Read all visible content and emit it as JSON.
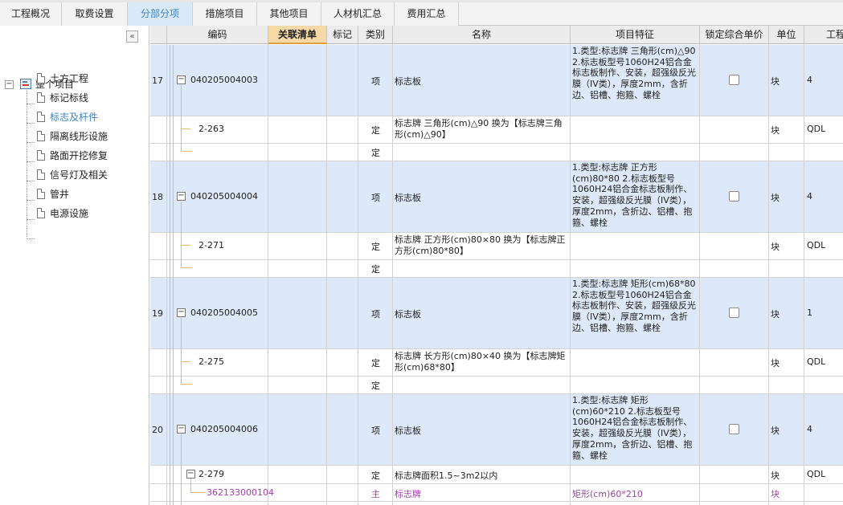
{
  "tabs": [
    {
      "label": "工程概况"
    },
    {
      "label": "取费设置"
    },
    {
      "label": "分部分项"
    },
    {
      "label": "措施项目"
    },
    {
      "label": "其他项目"
    },
    {
      "label": "人材机汇总"
    },
    {
      "label": "费用汇总"
    }
  ],
  "active_tab": "分部分项",
  "tree": {
    "collapse_glyph": "«",
    "root_label": "整个项目",
    "items": [
      {
        "label": "土方工程"
      },
      {
        "label": "标记标线"
      },
      {
        "label": "标志及杆件"
      },
      {
        "label": "隔离线形设施"
      },
      {
        "label": "路面开挖修复"
      },
      {
        "label": "信号灯及相关"
      },
      {
        "label": "管井"
      },
      {
        "label": "电源设施"
      }
    ],
    "selected_index": 2
  },
  "grid": {
    "headers": [
      "编码",
      "关联清单",
      "标记",
      "类别",
      "名称",
      "项目特征",
      "锁定综合单价",
      "单位",
      "工程"
    ],
    "highlight_header": "关联清单",
    "groups": [
      {
        "no": "17",
        "code": "040205004003",
        "category": "项",
        "name": "标志板",
        "features": "1.类型:标志牌 三角形(cm)△90 2.标志板型号1060H24铝合金标志板制作、安装，超强级反光膜（IV类），厚度2mm，含折边、铝槽、抱箍、螺栓",
        "unit": "块",
        "qty": "4",
        "sub_code": "2-263",
        "sub_category": "定",
        "sub_name": "标志牌 三角形(cm)△90  换为【标志牌三角形(cm)△90】",
        "sub_unit": "块",
        "sub_qty": "QDL",
        "empty_category": "定"
      },
      {
        "no": "18",
        "code": "040205004004",
        "category": "项",
        "name": "标志板",
        "features": "1.类型:标志牌 正方形(cm)80*80 2.标志板型号1060H24铝合金标志板制作、安装，超强级反光膜（IV类），厚度2mm，含折边、铝槽、抱箍、螺栓",
        "unit": "块",
        "qty": "4",
        "sub_code": "2-271",
        "sub_category": "定",
        "sub_name": "标志牌 正方形(cm)80×80  换为【标志牌正方形(cm)80*80】",
        "sub_unit": "块",
        "sub_qty": "QDL",
        "empty_category": "定"
      },
      {
        "no": "19",
        "code": "040205004005",
        "category": "项",
        "name": "标志板",
        "features": "1.类型:标志牌 矩形(cm)68*80 2.标志板型号1060H24铝合金标志板制作、安装，超强级反光膜（IV类），厚度2mm，含折边、铝槽、抱箍、螺栓",
        "unit": "块",
        "qty": "1",
        "sub_code": "2-275",
        "sub_category": "定",
        "sub_name": "标志牌 长方形(cm)80×40  换为【标志牌矩形(cm)68*80】",
        "sub_unit": "块",
        "sub_qty": "QDL",
        "empty_category": "定"
      },
      {
        "no": "20",
        "code": "040205004006",
        "category": "项",
        "name": "标志板",
        "features": "1.类型:标志牌 矩形(cm)60*210 2.标志板型号1060H24铝合金标志板制作、安装，超强级反光膜（IV类），厚度2mm，含折边、铝槽、抱箍、螺栓",
        "unit": "块",
        "qty": "4",
        "sub_code": "2-279",
        "sub_category": "定",
        "sub_name": "标志牌面积1.5~3m2以内",
        "sub_unit": "块",
        "sub_qty": "QDL"
      }
    ],
    "material_row": {
      "code": "362133000104",
      "category": "主",
      "name": "标志牌",
      "features": "矩形(cm)60*210",
      "unit": "块"
    },
    "minus_glyph": "−"
  },
  "colors": {
    "tab_active_bg": "#d9e9f7",
    "tab_active_text": "#3c86c6",
    "row_highlight": "#dde9f8",
    "header_highlight": "#f7d9a8",
    "tree_line": "#e6b977",
    "material_text": "#a33fa8"
  }
}
